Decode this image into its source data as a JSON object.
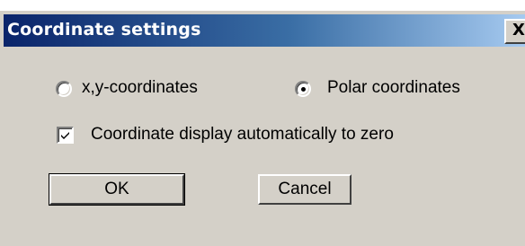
{
  "window": {
    "title": "Coordinate settings",
    "close_label": "X"
  },
  "options": {
    "xy_label": "x,y-coordinates",
    "polar_label": "Polar coordinates",
    "selected": "polar",
    "auto_zero_label": "Coordinate display automatically to zero",
    "auto_zero_checked": true
  },
  "buttons": {
    "ok_label": "OK",
    "cancel_label": "Cancel"
  },
  "colors": {
    "title_start": "#0a246a",
    "title_end": "#a6caf0",
    "face": "#d4d0c8"
  },
  "icons": {
    "close": "close-icon",
    "check": "checkmark-icon"
  }
}
